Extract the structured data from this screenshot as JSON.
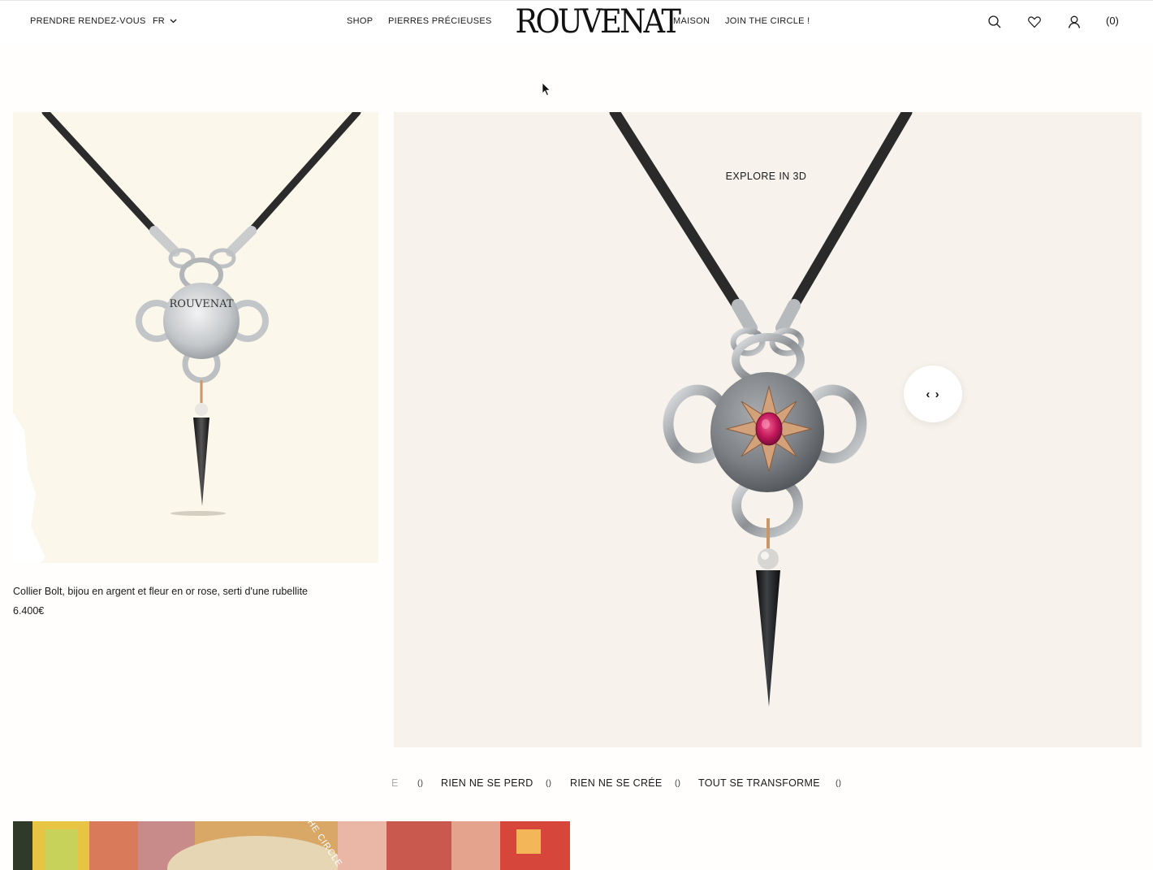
{
  "header": {
    "appointment_link": "PRENDRE RENDEZ-VOUS",
    "language": "FR",
    "shop_link": "SHOP",
    "gems_link": "PIERRES PRÉCIEUSES",
    "logo_text": "ROUVENAT",
    "maison_link": "MAISON",
    "circle_link": "JOIN THE CIRCLE !",
    "cart_count": "(0)"
  },
  "product": {
    "name": "Collier Bolt, bijou en argent et fleur en or rose, serti d'une rubellite",
    "price": "6.400€",
    "pendant_engraving": "ROUVENAT"
  },
  "viewer": {
    "explore_label": "EXPLORE IN 3D",
    "rotate_symbol": "‹ ›"
  },
  "marquee": {
    "fragment": "E",
    "items": [
      "RIEN NE SE PERD",
      "RIEN NE SE CRÉE",
      "TOUT SE TRANSFORME"
    ],
    "separator": "()"
  },
  "banner": {
    "overlay_text": "THE CIRCLE"
  },
  "colors": {
    "card_bg": "#fcf7eb",
    "viewer_bg": "#f7f3ec",
    "cord": "#2a2a2a",
    "silver": "#c9cbcd",
    "rose_gold": "#c9966b",
    "rubellite": "#c2185b"
  }
}
